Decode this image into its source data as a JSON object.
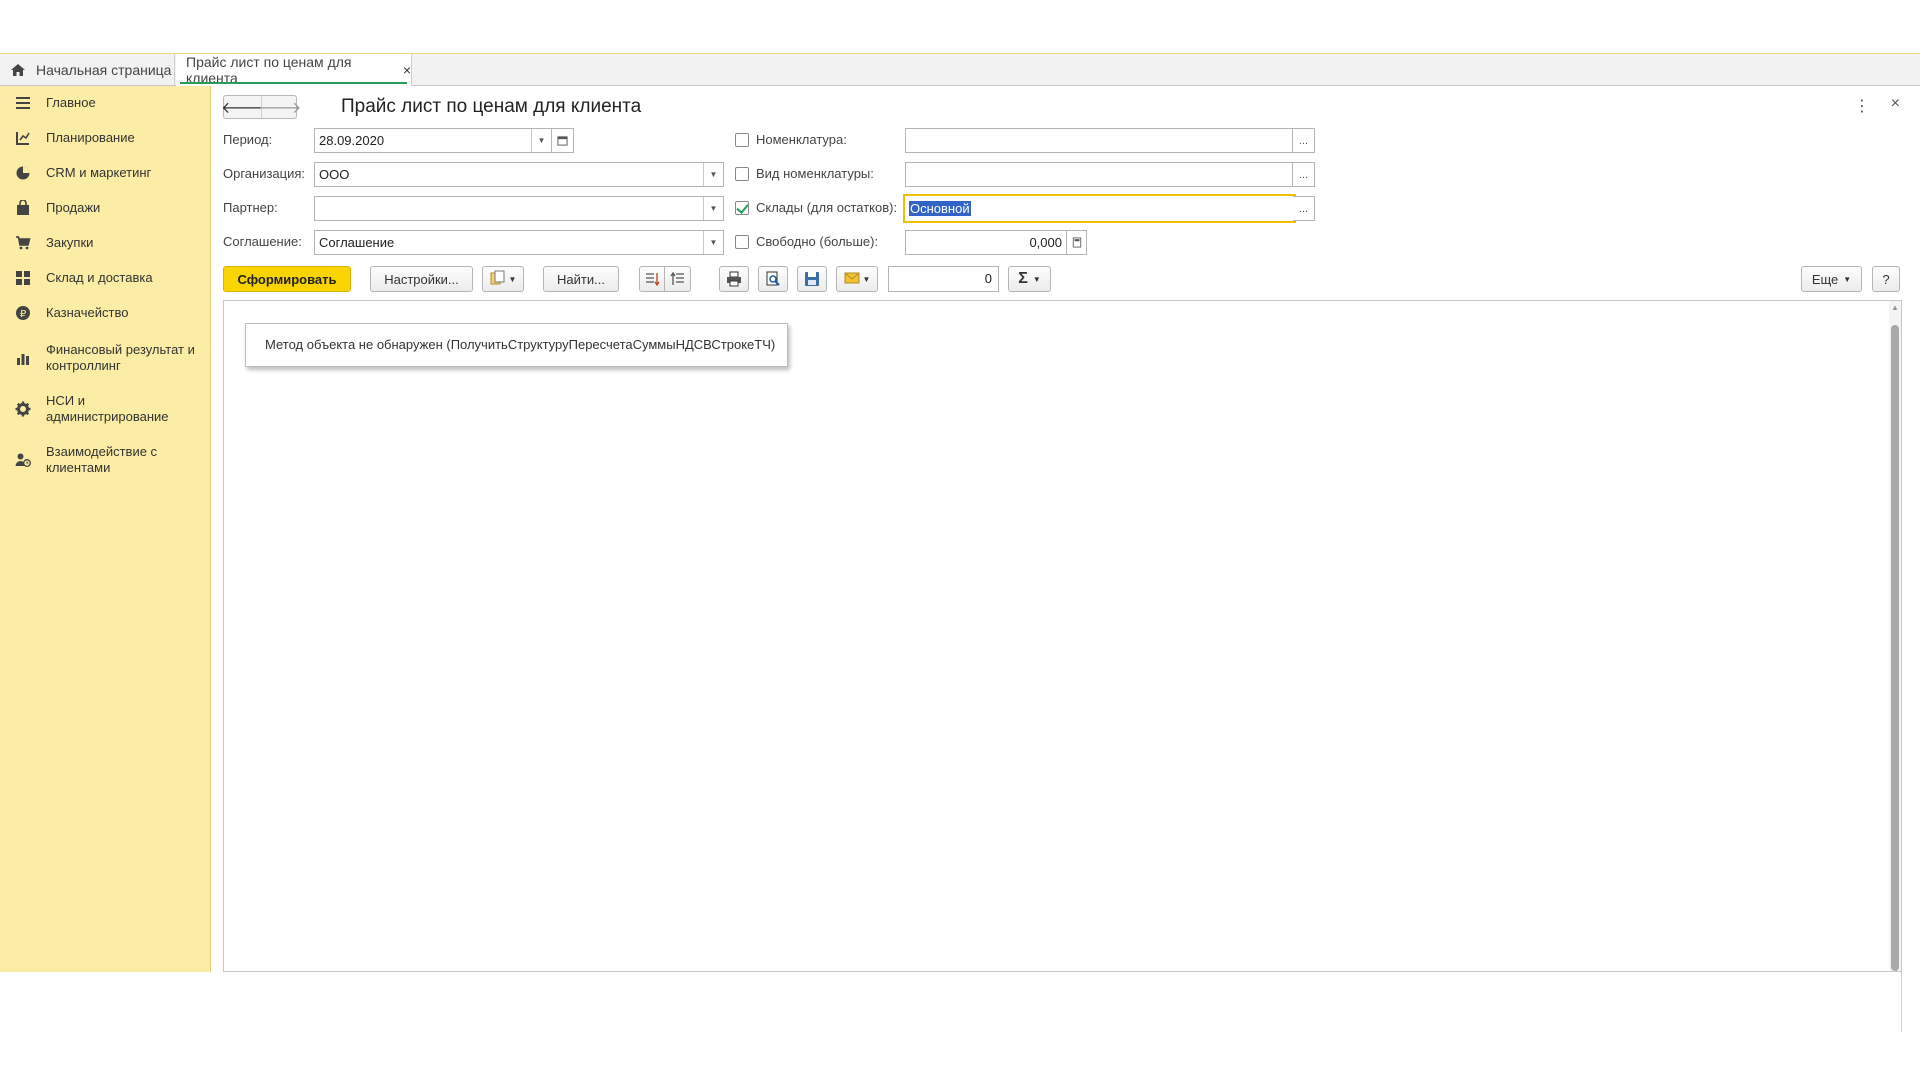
{
  "tabs": {
    "home_label": "Начальная страница",
    "active_label": "Прайс лист по ценам для клиента",
    "close_glyph": "×"
  },
  "sidebar": {
    "items": [
      {
        "label": "Главное",
        "icon": "menu-lines-icon"
      },
      {
        "label": "Планирование",
        "icon": "planning-icon"
      },
      {
        "label": "CRM и маркетинг",
        "icon": "pie-chart-icon"
      },
      {
        "label": "Продажи",
        "icon": "shopping-bag-icon"
      },
      {
        "label": "Закупки",
        "icon": "cart-icon"
      },
      {
        "label": "Склад и доставка",
        "icon": "warehouse-grid-icon"
      },
      {
        "label": "Казначейство",
        "icon": "ruble-coin-icon"
      },
      {
        "label": "Финансовый результат и контроллинг",
        "icon": "bar-chart-icon"
      },
      {
        "label": "НСИ и администрирование",
        "icon": "gear-icon"
      },
      {
        "label": "Взаимодействие с клиентами",
        "icon": "person-clock-icon"
      }
    ]
  },
  "header": {
    "back_glyph": "🡐",
    "forward_glyph": "🡒",
    "title": "Прайс лист по ценам для клиента",
    "more_glyph": "⋮",
    "close_glyph": "×"
  },
  "form": {
    "period_label": "Период:",
    "period_value": "28.09.2020",
    "org_label": "Организация:",
    "org_value": "ООО",
    "partner_label": "Партнер:",
    "partner_value": "",
    "agreement_label": "Соглашение:",
    "agreement_value": "Соглашение",
    "nomenclature_label": "Номенклатура:",
    "nomenclature_value": "",
    "nomenclature_checked": false,
    "nom_type_label": "Вид номенклатуры:",
    "nom_type_value": "",
    "nom_type_checked": false,
    "warehouses_label": "Склады (для остатков):",
    "warehouses_value": "Основной",
    "warehouses_checked": true,
    "free_label": "Свободно (больше):",
    "free_value": "0,000",
    "free_checked": false,
    "ellipsis": "..."
  },
  "toolbar": {
    "generate_label": "Сформировать",
    "settings_label": "Настройки...",
    "find_label": "Найти...",
    "counter_value": "0",
    "sigma_glyph": "Σ",
    "more_label": "Еще",
    "help_label": "?"
  },
  "report": {
    "message": "Метод объекта не обнаружен (ПолучитьСтруктуруПересчетаСуммыНДСВСтрокеТЧ)"
  },
  "colors": {
    "sidebar_bg": "#fbeda5",
    "primary_button": "#fad400",
    "accent_green": "#2a9d5c",
    "selection": "#3264c8"
  }
}
